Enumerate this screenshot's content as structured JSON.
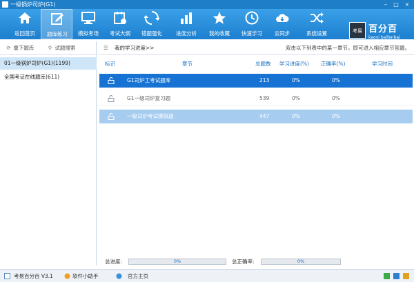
{
  "window": {
    "title": "一级锅炉司炉(G1)",
    "controls": [
      "minimize-icon",
      "maximize-icon",
      "close-icon"
    ]
  },
  "toolbar": {
    "items": [
      {
        "label": "返回首页",
        "icon": "home-icon"
      },
      {
        "label": "题库练习",
        "icon": "edit-icon",
        "active": true
      },
      {
        "label": "模拟考场",
        "icon": "monitor-icon"
      },
      {
        "label": "考试大纲",
        "icon": "calendar-icon"
      },
      {
        "label": "错题强化",
        "icon": "refresh-icon"
      },
      {
        "label": "进度分析",
        "icon": "bar-chart-icon"
      },
      {
        "label": "我的收藏",
        "icon": "star-icon"
      },
      {
        "label": "快速学习",
        "icon": "clock-icon"
      },
      {
        "label": "云同步",
        "icon": "cloud-icon"
      },
      {
        "label": "系统设置",
        "icon": "shuffle-icon"
      }
    ]
  },
  "brand": {
    "box_text": "考易",
    "name": "百分百",
    "sub": "kaoyi baifenbai"
  },
  "sidebar": {
    "tabs": [
      {
        "label": "重下题库",
        "icon": "refresh-icon"
      },
      {
        "label": "试题搜索",
        "icon": "search-icon"
      }
    ],
    "items": [
      {
        "label": "01一级锅炉司炉(G1)(1199)",
        "selected": true
      },
      {
        "label": "全国考证在线题库(611)",
        "selected": false
      }
    ]
  },
  "main": {
    "breadcrumb": "我的学习进度>>",
    "hint": "双击以下列表中的某一章节，即可进入相应章节答题。",
    "columns": [
      "标识",
      "章节",
      "总题数",
      "学习进度(%)",
      "正确率(%)",
      "学习时间"
    ],
    "rows": [
      {
        "chapter": "G1司炉工考试题库",
        "total": "213",
        "progress": "0%",
        "accuracy": "0%",
        "time": ""
      },
      {
        "chapter": "G1一级司炉复习题",
        "total": "539",
        "progress": "0%",
        "accuracy": "0%",
        "time": ""
      },
      {
        "chapter": "一级司炉考试模拟题",
        "total": "447",
        "progress": "0%",
        "accuracy": "0%",
        "time": ""
      }
    ]
  },
  "progress": {
    "total_label": "总进度:",
    "total_value": "0%",
    "total_fraction": 0,
    "accuracy_label": "总正确率:",
    "accuracy_value": "0%",
    "accuracy_fraction": 0
  },
  "status": {
    "app": "考易百分百 V3.1",
    "helper": "软件小助手",
    "homepage": "官方主页"
  },
  "colors": {
    "accent": "#1d7fcf",
    "row_selected": "#1773d3",
    "row_highlight": "#a6cdf0"
  }
}
